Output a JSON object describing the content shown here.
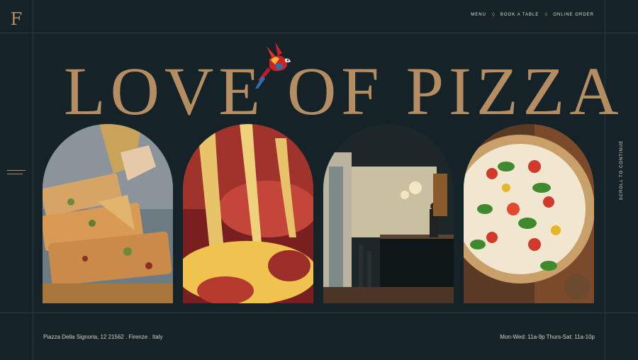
{
  "brand": {
    "logo_letter": "F"
  },
  "nav": {
    "items": [
      "MENU",
      "BOOK A TABLE",
      "ONLINE ORDER"
    ]
  },
  "hero": {
    "title": "LOVE OF PIZZA"
  },
  "side": {
    "scroll_label": "SCROLL TO CONTINUE"
  },
  "footer": {
    "address": "Piazza Della Signoria, 12 21562 . Firenze . Italy",
    "hours": "Mon-Wed: 11a-9p Thurs-Sat: 11a-10p"
  },
  "colors": {
    "background": "#152227",
    "accent": "#b58d62",
    "text": "#e6dfd3"
  },
  "images": [
    "flatbread-pizza-photo",
    "cheese-pull-photo",
    "restaurant-bar-photo",
    "margherita-pizza-photo"
  ]
}
